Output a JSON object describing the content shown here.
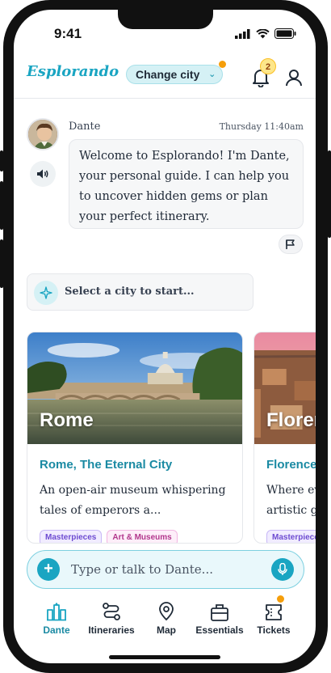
{
  "status_bar": {
    "time": "9:41"
  },
  "header": {
    "logo": "Esplorando",
    "change_city_label": "Change city",
    "notification_count": "2"
  },
  "message": {
    "sender": "Dante",
    "timestamp": "Thursday 11:40am",
    "text": "Welcome to Esplorando! I'm Dante, your personal guide. I can help you to uncover hidden gems or plan your perfect itinerary."
  },
  "prompt": {
    "select_city": "Select a city to start..."
  },
  "cards": [
    {
      "city": "Rome",
      "title": "Rome, The Eternal City",
      "description": "An open-air museum whispering tales of emperors a...",
      "tags": [
        "Masterpieces",
        "Art & Museums"
      ]
    },
    {
      "city": "Florence",
      "title": "Florence",
      "description": "Where every corner reveals artistic g",
      "tags": [
        "Masterpieces"
      ]
    }
  ],
  "composer": {
    "placeholder": "Type or talk to Dante..."
  },
  "tabs": [
    {
      "label": "Dante",
      "icon": "dante-icon"
    },
    {
      "label": "Itineraries",
      "icon": "route-icon"
    },
    {
      "label": "Map",
      "icon": "map-pin-icon"
    },
    {
      "label": "Essentials",
      "icon": "suitcase-icon"
    },
    {
      "label": "Tickets",
      "icon": "ticket-icon"
    }
  ],
  "colors": {
    "accent": "#1aa5c2",
    "badge": "#f59e0b"
  }
}
